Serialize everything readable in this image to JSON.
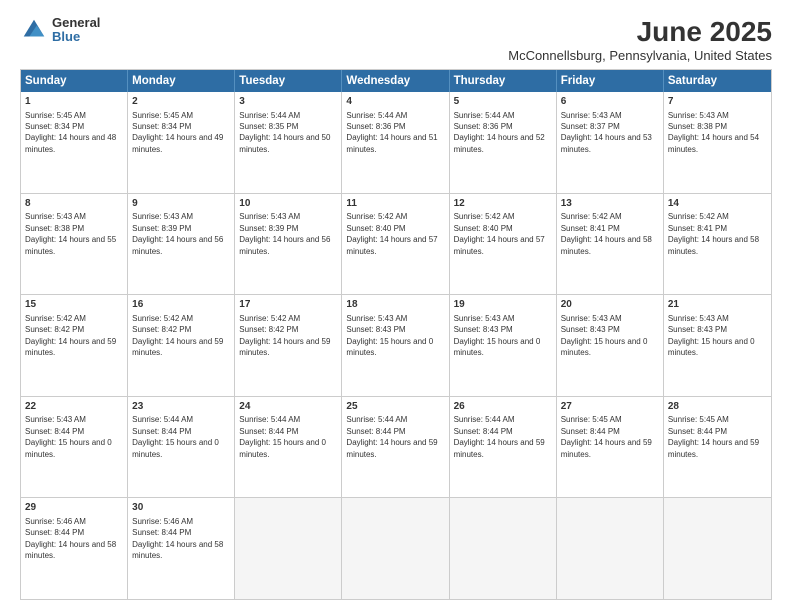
{
  "logo": {
    "general": "General",
    "blue": "Blue"
  },
  "title": "June 2025",
  "subtitle": "McConnellsburg, Pennsylvania, United States",
  "header_days": [
    "Sunday",
    "Monday",
    "Tuesday",
    "Wednesday",
    "Thursday",
    "Friday",
    "Saturday"
  ],
  "weeks": [
    [
      {
        "day": "1",
        "text": "Sunrise: 5:45 AM\nSunset: 8:34 PM\nDaylight: 14 hours and 48 minutes."
      },
      {
        "day": "2",
        "text": "Sunrise: 5:45 AM\nSunset: 8:34 PM\nDaylight: 14 hours and 49 minutes."
      },
      {
        "day": "3",
        "text": "Sunrise: 5:44 AM\nSunset: 8:35 PM\nDaylight: 14 hours and 50 minutes."
      },
      {
        "day": "4",
        "text": "Sunrise: 5:44 AM\nSunset: 8:36 PM\nDaylight: 14 hours and 51 minutes."
      },
      {
        "day": "5",
        "text": "Sunrise: 5:44 AM\nSunset: 8:36 PM\nDaylight: 14 hours and 52 minutes."
      },
      {
        "day": "6",
        "text": "Sunrise: 5:43 AM\nSunset: 8:37 PM\nDaylight: 14 hours and 53 minutes."
      },
      {
        "day": "7",
        "text": "Sunrise: 5:43 AM\nSunset: 8:38 PM\nDaylight: 14 hours and 54 minutes."
      }
    ],
    [
      {
        "day": "8",
        "text": "Sunrise: 5:43 AM\nSunset: 8:38 PM\nDaylight: 14 hours and 55 minutes."
      },
      {
        "day": "9",
        "text": "Sunrise: 5:43 AM\nSunset: 8:39 PM\nDaylight: 14 hours and 56 minutes."
      },
      {
        "day": "10",
        "text": "Sunrise: 5:43 AM\nSunset: 8:39 PM\nDaylight: 14 hours and 56 minutes."
      },
      {
        "day": "11",
        "text": "Sunrise: 5:42 AM\nSunset: 8:40 PM\nDaylight: 14 hours and 57 minutes."
      },
      {
        "day": "12",
        "text": "Sunrise: 5:42 AM\nSunset: 8:40 PM\nDaylight: 14 hours and 57 minutes."
      },
      {
        "day": "13",
        "text": "Sunrise: 5:42 AM\nSunset: 8:41 PM\nDaylight: 14 hours and 58 minutes."
      },
      {
        "day": "14",
        "text": "Sunrise: 5:42 AM\nSunset: 8:41 PM\nDaylight: 14 hours and 58 minutes."
      }
    ],
    [
      {
        "day": "15",
        "text": "Sunrise: 5:42 AM\nSunset: 8:42 PM\nDaylight: 14 hours and 59 minutes."
      },
      {
        "day": "16",
        "text": "Sunrise: 5:42 AM\nSunset: 8:42 PM\nDaylight: 14 hours and 59 minutes."
      },
      {
        "day": "17",
        "text": "Sunrise: 5:42 AM\nSunset: 8:42 PM\nDaylight: 14 hours and 59 minutes."
      },
      {
        "day": "18",
        "text": "Sunrise: 5:43 AM\nSunset: 8:43 PM\nDaylight: 15 hours and 0 minutes."
      },
      {
        "day": "19",
        "text": "Sunrise: 5:43 AM\nSunset: 8:43 PM\nDaylight: 15 hours and 0 minutes."
      },
      {
        "day": "20",
        "text": "Sunrise: 5:43 AM\nSunset: 8:43 PM\nDaylight: 15 hours and 0 minutes."
      },
      {
        "day": "21",
        "text": "Sunrise: 5:43 AM\nSunset: 8:43 PM\nDaylight: 15 hours and 0 minutes."
      }
    ],
    [
      {
        "day": "22",
        "text": "Sunrise: 5:43 AM\nSunset: 8:44 PM\nDaylight: 15 hours and 0 minutes."
      },
      {
        "day": "23",
        "text": "Sunrise: 5:44 AM\nSunset: 8:44 PM\nDaylight: 15 hours and 0 minutes."
      },
      {
        "day": "24",
        "text": "Sunrise: 5:44 AM\nSunset: 8:44 PM\nDaylight: 15 hours and 0 minutes."
      },
      {
        "day": "25",
        "text": "Sunrise: 5:44 AM\nSunset: 8:44 PM\nDaylight: 14 hours and 59 minutes."
      },
      {
        "day": "26",
        "text": "Sunrise: 5:44 AM\nSunset: 8:44 PM\nDaylight: 14 hours and 59 minutes."
      },
      {
        "day": "27",
        "text": "Sunrise: 5:45 AM\nSunset: 8:44 PM\nDaylight: 14 hours and 59 minutes."
      },
      {
        "day": "28",
        "text": "Sunrise: 5:45 AM\nSunset: 8:44 PM\nDaylight: 14 hours and 59 minutes."
      }
    ],
    [
      {
        "day": "29",
        "text": "Sunrise: 5:46 AM\nSunset: 8:44 PM\nDaylight: 14 hours and 58 minutes."
      },
      {
        "day": "30",
        "text": "Sunrise: 5:46 AM\nSunset: 8:44 PM\nDaylight: 14 hours and 58 minutes."
      },
      {
        "day": "",
        "text": ""
      },
      {
        "day": "",
        "text": ""
      },
      {
        "day": "",
        "text": ""
      },
      {
        "day": "",
        "text": ""
      },
      {
        "day": "",
        "text": ""
      }
    ]
  ]
}
